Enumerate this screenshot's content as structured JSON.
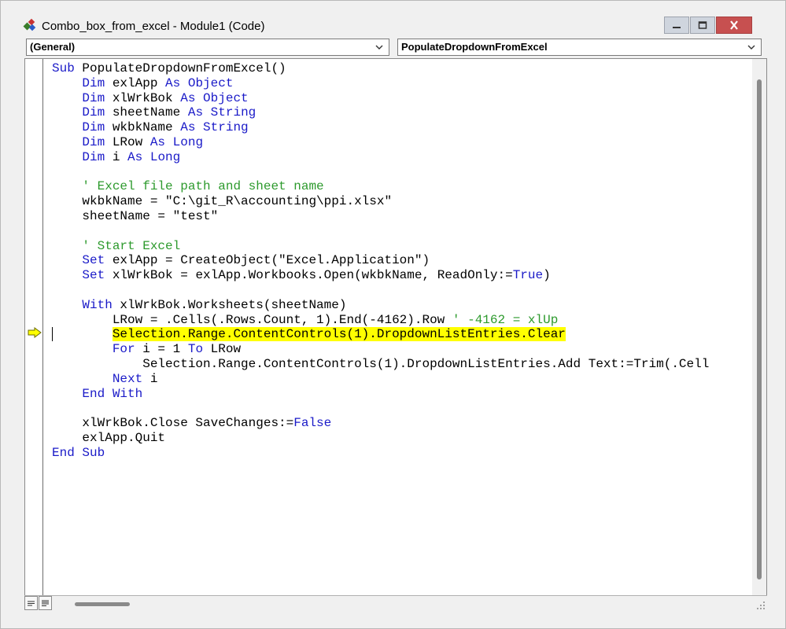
{
  "window": {
    "title": "Combo_box_from_excel - Module1 (Code)",
    "app_icon": "vba-code-icon"
  },
  "toolbar": {
    "object_combo": "(General)",
    "procedure_combo": "PopulateDropdownFromExcel"
  },
  "code": {
    "current_line_index": 18,
    "lines": [
      [
        {
          "t": "Sub",
          "k": "kw"
        },
        {
          "t": " PopulateDropdownFromExcel()"
        }
      ],
      [
        {
          "t": "    "
        },
        {
          "t": "Dim",
          "k": "kw"
        },
        {
          "t": " exlApp "
        },
        {
          "t": "As",
          "k": "kw"
        },
        {
          "t": " "
        },
        {
          "t": "Object",
          "k": "kw"
        }
      ],
      [
        {
          "t": "    "
        },
        {
          "t": "Dim",
          "k": "kw"
        },
        {
          "t": " xlWrkBok "
        },
        {
          "t": "As",
          "k": "kw"
        },
        {
          "t": " "
        },
        {
          "t": "Object",
          "k": "kw"
        }
      ],
      [
        {
          "t": "    "
        },
        {
          "t": "Dim",
          "k": "kw"
        },
        {
          "t": " sheetName "
        },
        {
          "t": "As",
          "k": "kw"
        },
        {
          "t": " "
        },
        {
          "t": "String",
          "k": "kw"
        }
      ],
      [
        {
          "t": "    "
        },
        {
          "t": "Dim",
          "k": "kw"
        },
        {
          "t": " wkbkName "
        },
        {
          "t": "As",
          "k": "kw"
        },
        {
          "t": " "
        },
        {
          "t": "String",
          "k": "kw"
        }
      ],
      [
        {
          "t": "    "
        },
        {
          "t": "Dim",
          "k": "kw"
        },
        {
          "t": " LRow "
        },
        {
          "t": "As",
          "k": "kw"
        },
        {
          "t": " "
        },
        {
          "t": "Long",
          "k": "kw"
        }
      ],
      [
        {
          "t": "    "
        },
        {
          "t": "Dim",
          "k": "kw"
        },
        {
          "t": " i "
        },
        {
          "t": "As",
          "k": "kw"
        },
        {
          "t": " "
        },
        {
          "t": "Long",
          "k": "kw"
        }
      ],
      [],
      [
        {
          "t": "    "
        },
        {
          "t": "' Excel file path and sheet name",
          "k": "cm"
        }
      ],
      [
        {
          "t": "    wkbkName = \"C:\\git_R\\accounting\\ppi.xlsx\""
        }
      ],
      [
        {
          "t": "    sheetName = \"test\""
        }
      ],
      [],
      [
        {
          "t": "    "
        },
        {
          "t": "' Start Excel",
          "k": "cm"
        }
      ],
      [
        {
          "t": "    "
        },
        {
          "t": "Set",
          "k": "kw"
        },
        {
          "t": " exlApp = CreateObject(\"Excel.Application\")"
        }
      ],
      [
        {
          "t": "    "
        },
        {
          "t": "Set",
          "k": "kw"
        },
        {
          "t": " xlWrkBok = exlApp.Workbooks.Open(wkbkName, ReadOnly:="
        },
        {
          "t": "True",
          "k": "kw"
        },
        {
          "t": ")"
        }
      ],
      [],
      [
        {
          "t": "    "
        },
        {
          "t": "With",
          "k": "kw"
        },
        {
          "t": " xlWrkBok.Worksheets(sheetName)"
        }
      ],
      [
        {
          "t": "        LRow = .Cells(.Rows.Count, 1).End(-4162).Row "
        },
        {
          "t": "' -4162 = xlUp",
          "k": "cm"
        }
      ],
      [
        {
          "t": "        "
        },
        {
          "t": "Selection.Range.ContentControls(1).DropdownListEntries.Clear",
          "k": "hl"
        }
      ],
      [
        {
          "t": "        "
        },
        {
          "t": "For",
          "k": "kw"
        },
        {
          "t": " i = 1 "
        },
        {
          "t": "To",
          "k": "kw"
        },
        {
          "t": " LRow"
        }
      ],
      [
        {
          "t": "            Selection.Range.ContentControls(1).DropdownListEntries.Add Text:=Trim(.Cell"
        }
      ],
      [
        {
          "t": "        "
        },
        {
          "t": "Next",
          "k": "kw"
        },
        {
          "t": " i"
        }
      ],
      [
        {
          "t": "    "
        },
        {
          "t": "End With",
          "k": "kw"
        }
      ],
      [],
      [
        {
          "t": "    xlWrkBok.Close SaveChanges:="
        },
        {
          "t": "False",
          "k": "kw"
        }
      ],
      [
        {
          "t": "    exlApp.Quit"
        }
      ],
      [
        {
          "t": "End Sub",
          "k": "kw"
        }
      ]
    ]
  },
  "colors": {
    "keyword": "#1a1ac8",
    "comment": "#2d9a2d",
    "highlight": "#ffff00",
    "exec_arrow": "#ffff00"
  }
}
